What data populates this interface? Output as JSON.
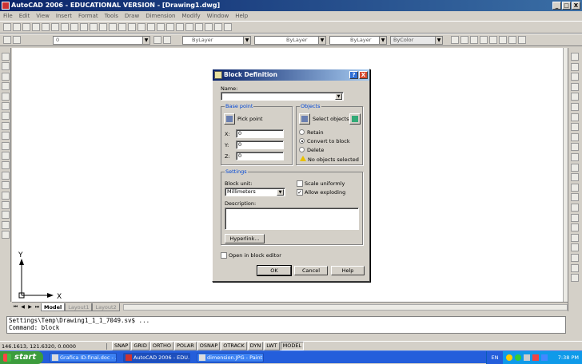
{
  "window": {
    "title": "AutoCAD 2006 - EDUCATIONAL VERSION - [Drawing1.dwg]",
    "minimize": "_",
    "maximize": "□",
    "close": "X"
  },
  "menu": [
    "File",
    "Edit",
    "View",
    "Insert",
    "Format",
    "Tools",
    "Draw",
    "Dimension",
    "Modify",
    "Window",
    "Help"
  ],
  "toolbar": {
    "layer_value": "0",
    "color_value": "ByLayer",
    "linetype_value": "ByLayer",
    "lineweight_value": "ByLayer",
    "plotstyle_value": "ByColor"
  },
  "layout_tabs": [
    "Model",
    "Layout1",
    "Layout2"
  ],
  "command_lines": [
    "Settings\\Temp\\Drawing1_1_1_7049.sv$ ...",
    "Command: block"
  ],
  "status": {
    "coords": "146.1613, 121.6320, 0.0000",
    "buttons": [
      "SNAP",
      "GRID",
      "ORTHO",
      "POLAR",
      "OSNAP",
      "OTRACK",
      "DYN",
      "LWT",
      "MODEL"
    ]
  },
  "ucs": {
    "x": "X",
    "y": "Y"
  },
  "dialog": {
    "title": "Block Definition",
    "help_glyph": "?",
    "close_glyph": "X",
    "name_label": "Name:",
    "name_value": "",
    "base_point": {
      "group_label": "Base point",
      "pick_point": "Pick point",
      "x_label": "X:",
      "x_value": "0",
      "y_label": "Y:",
      "y_value": "0",
      "z_label": "Z:",
      "z_value": "0"
    },
    "objects": {
      "group_label": "Objects",
      "select_objects": "Select objects",
      "retain": "Retain",
      "convert": "Convert to block",
      "delete": "Delete",
      "selected_state": "convert",
      "status_text": "No objects selected"
    },
    "settings": {
      "group_label": "Settings",
      "block_unit_label": "Block unit:",
      "block_unit_value": "Millimeters",
      "scale_uniformly": "Scale uniformly",
      "scale_uniformly_checked": false,
      "allow_exploding": "Allow exploding",
      "allow_exploding_checked": true,
      "description_label": "Description:",
      "description_value": "",
      "hyperlink_button": "Hyperlink..."
    },
    "open_in_editor": "Open in block editor",
    "open_in_editor_checked": false,
    "ok": "OK",
    "cancel": "Cancel",
    "help": "Help"
  },
  "taskbar": {
    "start": "start",
    "items": [
      "Grafica ID-final.doc - ...",
      "AutoCAD 2006 - EDU...",
      "dimension.JPG - Paint"
    ],
    "active_index": 1,
    "lang": "EN",
    "clock": "7:38 PM"
  }
}
